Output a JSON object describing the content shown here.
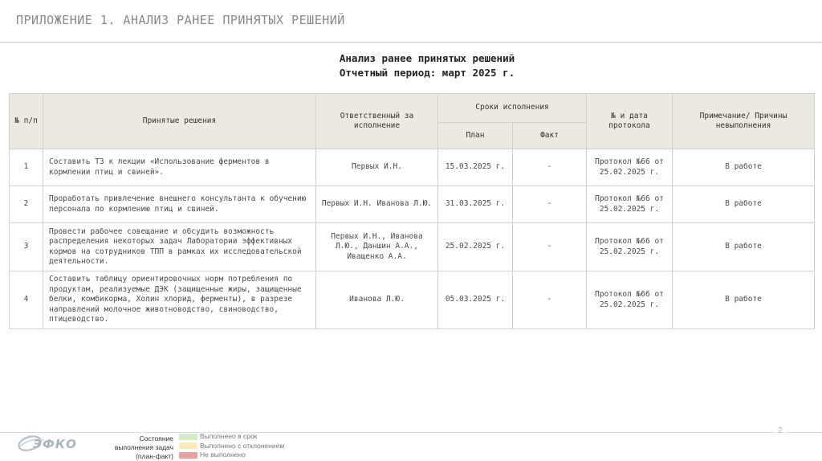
{
  "header": {
    "title": "ПРИЛОЖЕНИЕ 1. АНАЛИЗ РАНЕЕ ПРИНЯТЫХ РЕШЕНИЙ"
  },
  "heading": {
    "line1": "Анализ ранее принятых решений",
    "line2": "Отчетный период: март 2025 г."
  },
  "table": {
    "columns": {
      "num": "№ п/п",
      "decision": "Принятые решения",
      "responsible": "Ответственный за исполнение",
      "deadlines": "Сроки исполнения",
      "plan": "План",
      "fact": "Факт",
      "protocol": "№ и дата протокола",
      "note": "Примечание/ Причины невыполнения"
    },
    "rows": [
      {
        "num": "1",
        "decision": "Составить ТЗ к лекции «Использование ферментов в кормлении птиц и свиней».",
        "responsible": "Первых И.Н.",
        "plan": "15.03.2025 г.",
        "fact": "-",
        "protocol": "Протокол №66 от 25.02.2025 г.",
        "note": "В работе"
      },
      {
        "num": "2",
        "decision": "Проработать привлечение внешнего консультанта к обучению персонала по кормлению птиц и свиней.",
        "responsible": "Первых И.Н. Иванова Л.Ю.",
        "plan": "31.03.2025 г.",
        "fact": "-",
        "protocol": "Протокол №66 от 25.02.2025 г.",
        "note": "В работе"
      },
      {
        "num": "3",
        "decision": "Провести рабочее совещание и обсудить возможность распределения некоторых задач Лаборатории эффективных кормов на сотрудников ТПП в рамках их исследовательской деятельности.",
        "responsible": "Первых И.Н., Иванова Л.Ю., Даншин А.А., Иващенко А.А.",
        "plan": "25.02.2025 г.",
        "fact": "-",
        "protocol": "Протокол №66 от 25.02.2025 г.",
        "note": "В работе"
      },
      {
        "num": "4",
        "decision": "Составить таблицу ориентировочных норм потребления по продуктам, реализуемые ДЭК (защищенные жиры, защищенные белки, комбикорма, Холин хлорид, ферменты), в разрезе направлений молочное животноводство, свиноводство, птицеводство.",
        "responsible": "Иванова Л.Ю.",
        "plan": "05.03.2025 г.",
        "fact": "-",
        "protocol": "Протокол №66 от 25.02.2025 г.",
        "note": "В работе"
      }
    ]
  },
  "footer": {
    "logo_text": "ЭФКО",
    "status_caption": "Состояние выполнения задач (план-факт)",
    "legend": [
      {
        "label": "Выполнено в срок",
        "color": "#d4ecc8"
      },
      {
        "label": "Выполнено с отклонением",
        "color": "#fbe9b9"
      },
      {
        "label": "Не выполнено",
        "color": "#e8a0a0"
      }
    ],
    "page_number": "2"
  }
}
